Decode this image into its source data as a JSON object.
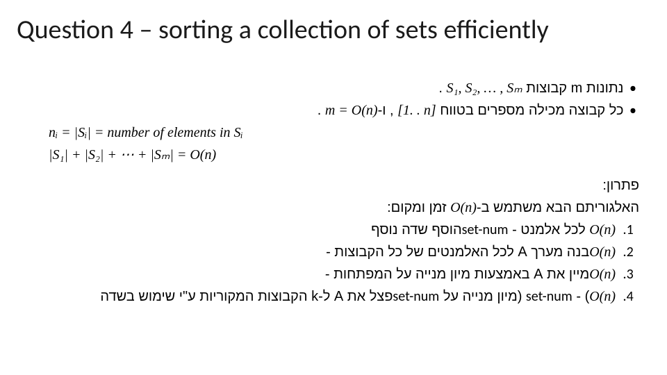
{
  "title": "Question 4 – sorting a collection of sets efficiently",
  "intro": {
    "line1_he_a": "נתונות m קבוצות ",
    "line1_math": "S₁, S₂, … , Sₘ",
    "line1_he_b": " .",
    "line2_he_a": "כל קבוצה מכילה מספרים בטווח ",
    "line2_math_a": "[1. . n]",
    "line2_mid": " , ו-",
    "line2_math_b": "m = O(n)",
    "line2_end": " .",
    "line3_math": "nᵢ = |Sᵢ| = number of elements in Sᵢ",
    "line4_math": "|S₁| + |S₂| + ⋯ + |Sₘ| = O(n)"
  },
  "solution_label": "פתרון:",
  "solution_intro_a": "האלגוריתם הבא משתמש ב-",
  "solution_intro_math": "O(n)",
  "solution_intro_b": " זמן ומקום:",
  "steps": {
    "s1_a": "הוסף שדה נוסף ",
    "s1_en": "set-num",
    "s1_b": " לכל אלמנט - ",
    "s1_m": "O(n)",
    "s2_a": "בנה מערך A לכל האלמנטים של כל הקבוצות - ",
    "s2_m": "O(n)",
    "s3_a": "מיין את A באמצעות מיון מנייה על המפתחות - ",
    "s3_m": "O(n)",
    "s4_a": "פצל את A ל-k הקבוצות המקוריות ע\"י שימוש בשדה ",
    "s4_en": "set-num",
    "s4_b": " (מיון מנייה על ",
    "s4_en2": "set-num",
    "s4_c": ") - ",
    "s4_m": "O(n)"
  }
}
